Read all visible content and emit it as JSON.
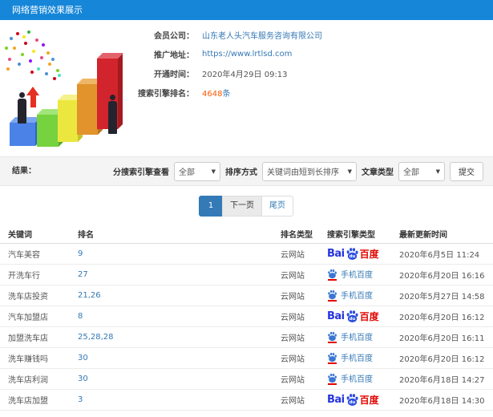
{
  "titlebar": {
    "title": "网络营销效果展示"
  },
  "info": {
    "company_label": "会员公司：",
    "company_value": "山东老人头汽车服务咨询有限公司",
    "url_label": "推广地址：",
    "url_value": "https://www.lrtlsd.com",
    "opened_label": "开通时间：",
    "opened_value": "2020年4月29日 09:13",
    "rank_label": "搜索引擎排名：",
    "rank_count": "4648",
    "rank_unit": "条"
  },
  "filters": {
    "result_label": "结果：",
    "engine_label": "分搜索引擎查看",
    "engine_value": "全部",
    "sort_label": "排序方式",
    "sort_value": "关键词由短到长排序",
    "type_label": "文章类型",
    "type_value": "全部",
    "submit": "提交"
  },
  "pagination": {
    "page1": "1",
    "next": "下一页",
    "last": "尾页"
  },
  "baidu_logo": {
    "prefix": "Bai",
    "paw_text": "du",
    "suffix": "百度"
  },
  "table": {
    "headers": [
      "关键词",
      "排名",
      "排名类型",
      "搜索引擎类型",
      "最新更新时间"
    ],
    "rows": [
      {
        "keyword": "汽车美容",
        "rank": "9",
        "rank_type": "云网站",
        "engine": "baidu-pc",
        "engine_label": "百度",
        "updated": "2020年6月5日 11:24"
      },
      {
        "keyword": "开洗车行",
        "rank": "27",
        "rank_type": "云网站",
        "engine": "baidu-mobile",
        "engine_label": "手机百度",
        "updated": "2020年6月20日 16:16"
      },
      {
        "keyword": "洗车店投资",
        "rank": "21,26",
        "rank_type": "云网站",
        "engine": "baidu-mobile",
        "engine_label": "手机百度",
        "updated": "2020年5月27日 14:58"
      },
      {
        "keyword": "汽车加盟店",
        "rank": "8",
        "rank_type": "云网站",
        "engine": "baidu-pc",
        "engine_label": "百度",
        "updated": "2020年6月20日 16:12"
      },
      {
        "keyword": "加盟洗车店",
        "rank": "25,28,28",
        "rank_type": "云网站",
        "engine": "baidu-mobile",
        "engine_label": "手机百度",
        "updated": "2020年6月20日 16:11"
      },
      {
        "keyword": "洗车赚钱吗",
        "rank": "30",
        "rank_type": "云网站",
        "engine": "baidu-mobile",
        "engine_label": "手机百度",
        "updated": "2020年6月20日 16:12"
      },
      {
        "keyword": "洗车店利润",
        "rank": "30",
        "rank_type": "云网站",
        "engine": "baidu-mobile",
        "engine_label": "手机百度",
        "updated": "2020年6月18日 14:27"
      },
      {
        "keyword": "洗车店加盟",
        "rank": "3",
        "rank_type": "云网站",
        "engine": "baidu-pc",
        "engine_label": "百度",
        "updated": "2020年6月18日 14:30"
      }
    ]
  },
  "colors": {
    "topbar_blue": "#1586d8",
    "link_blue": "#3478b5",
    "accent_orange": "#ff5a00",
    "baidu_blue": "#2534dc",
    "baidu_red": "#e10600",
    "pagination_active": "#337ab7",
    "filter_bar_bg": "#f4f4f4"
  }
}
